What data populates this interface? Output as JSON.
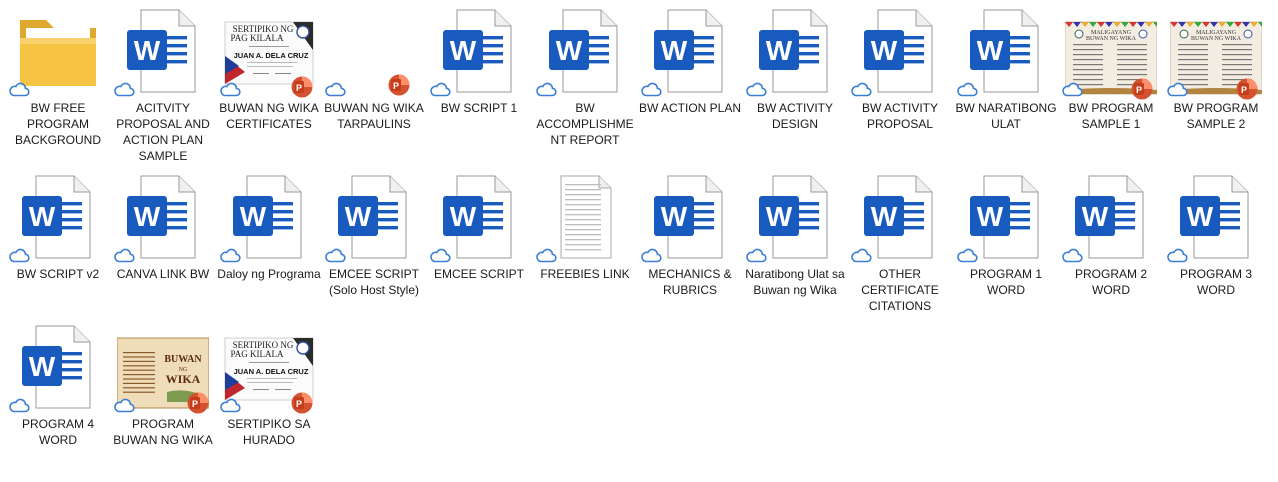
{
  "items": [
    {
      "label": "BW FREE PROGRAM BACKGROUND",
      "kind": "folder"
    },
    {
      "label": "ACITVITY PROPOSAL AND ACTION PLAN SAMPLE",
      "kind": "word"
    },
    {
      "label": "BUWAN NG WIKA CERTIFICATES",
      "kind": "ppt-cert"
    },
    {
      "label": "BUWAN NG WIKA TARPAULINS",
      "kind": "ppt-blank"
    },
    {
      "label": "BW  SCRIPT 1",
      "kind": "word"
    },
    {
      "label": "BW ACCOMPLISHMENT REPORT",
      "kind": "word"
    },
    {
      "label": "BW ACTION PLAN",
      "kind": "word"
    },
    {
      "label": "BW ACTIVITY DESIGN",
      "kind": "word"
    },
    {
      "label": "BW ACTIVITY PROPOSAL",
      "kind": "word"
    },
    {
      "label": "BW NARATIBONG ULAT",
      "kind": "word"
    },
    {
      "label": "BW PROGRAM SAMPLE 1",
      "kind": "ppt-program"
    },
    {
      "label": "BW PROGRAM SAMPLE 2",
      "kind": "ppt-program"
    },
    {
      "label": "BW SCRIPT v2",
      "kind": "word"
    },
    {
      "label": "CANVA LINK BW",
      "kind": "word"
    },
    {
      "label": "Daloy ng Programa",
      "kind": "word"
    },
    {
      "label": "EMCEE SCRIPT (Solo Host Style)",
      "kind": "word"
    },
    {
      "label": "EMCEE SCRIPT",
      "kind": "word"
    },
    {
      "label": "FREEBIES LINK",
      "kind": "doc"
    },
    {
      "label": "MECHANICS & RUBRICS",
      "kind": "word"
    },
    {
      "label": "Naratibong Ulat sa Buwan ng Wika",
      "kind": "word"
    },
    {
      "label": "OTHER CERTIFICATE CITATIONS",
      "kind": "word"
    },
    {
      "label": "PROGRAM 1 WORD",
      "kind": "word"
    },
    {
      "label": "PROGRAM 2 WORD",
      "kind": "word"
    },
    {
      "label": "PROGRAM 3 WORD",
      "kind": "word"
    },
    {
      "label": "PROGRAM 4 WORD",
      "kind": "word"
    },
    {
      "label": "PROGRAM BUWAN NG WIKA",
      "kind": "ppt-poster"
    },
    {
      "label": "SERTIPIKO SA HURADO",
      "kind": "ppt-cert"
    }
  ],
  "thumbnails": {
    "cert_title_line1": "SERTIPIKO NG",
    "cert_title_line2": "PAG KILALA",
    "cert_name": "JUAN A. DELA CRUZ",
    "program_title_line1": "MALIGAYANG",
    "program_title_line2": "BUWAN NG WIKA",
    "poster_line1": "BUWAN",
    "poster_line2": "NG",
    "poster_line3": "WIKA"
  },
  "colors": {
    "word_blue": "#185abd",
    "ppt_red": "#d35230",
    "folder_yellow": "#f6c343",
    "cloud_blue": "#3a7fd5"
  }
}
